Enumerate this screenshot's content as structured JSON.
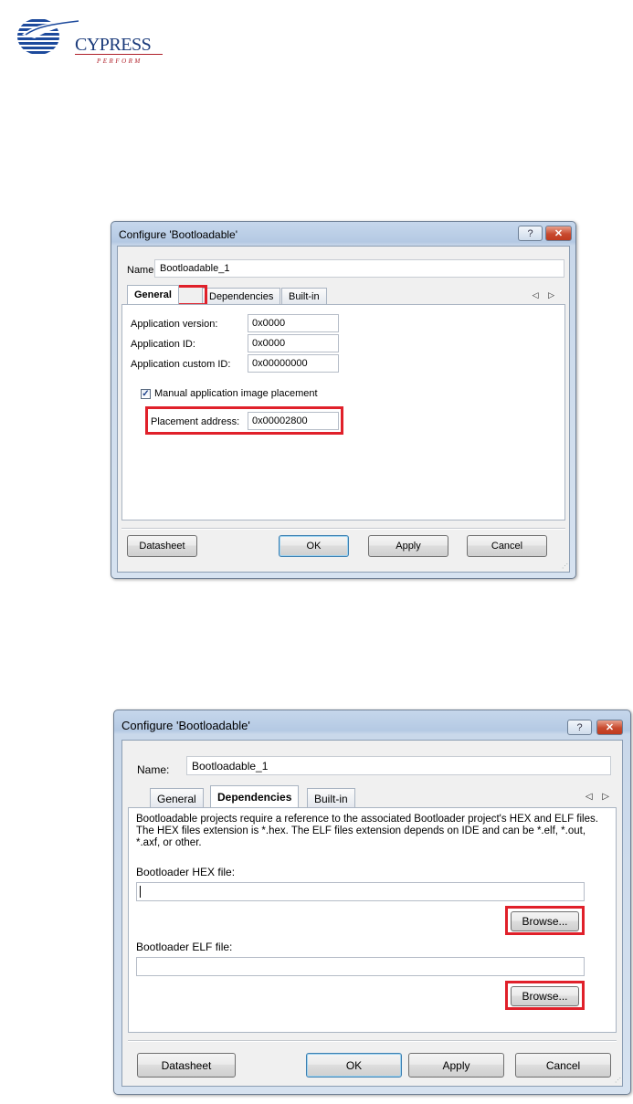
{
  "logo": {
    "brand": "CYPRESS",
    "tagline": "PERFORM"
  },
  "dialog1": {
    "title": "Configure 'Bootloadable'",
    "help_glyph": "?",
    "close_glyph": "✕",
    "name_label": "Name:",
    "name_value": "Bootloadable_1",
    "tabs": [
      "General",
      "Dependencies",
      "Built-in"
    ],
    "active_tab": "General",
    "tab_arrows": "◁ ▷",
    "fields": [
      {
        "label": "Application version:",
        "value": "0x0000"
      },
      {
        "label": "Application ID:",
        "value": "0x0000"
      },
      {
        "label": "Application custom ID:",
        "value": "0x00000000"
      }
    ],
    "checkbox_label": "Manual application image placement",
    "checkbox_checked": true,
    "check_glyph": "✓",
    "placement_label": "Placement address:",
    "placement_value": "0x00002800",
    "buttons": {
      "datasheet": "Datasheet",
      "ok": "OK",
      "apply": "Apply",
      "cancel": "Cancel"
    }
  },
  "dialog2": {
    "title": "Configure 'Bootloadable'",
    "help_glyph": "?",
    "close_glyph": "✕",
    "name_label": "Name:",
    "name_value": "Bootloadable_1",
    "tabs": [
      "General",
      "Dependencies",
      "Built-in"
    ],
    "active_tab": "Dependencies",
    "tab_arrows": "◁ ▷",
    "description": "Bootloadable projects require a reference to the associated Bootloader project's HEX and ELF files. The HEX files extension is *.hex. The ELF files extension depends on IDE and can be *.elf, *.out, *.axf, or other.",
    "hex_label": "Bootloader HEX file:",
    "hex_value": "",
    "elf_label": "Bootloader ELF file:",
    "elf_value": "",
    "browse_label": "Browse...",
    "buttons": {
      "datasheet": "Datasheet",
      "ok": "OK",
      "apply": "Apply",
      "cancel": "Cancel"
    }
  },
  "colors": {
    "highlight": "#e0202a",
    "brand_blue": "#1a3a7a",
    "brand_red": "#b0202a",
    "close_red": "#c84a2e"
  }
}
